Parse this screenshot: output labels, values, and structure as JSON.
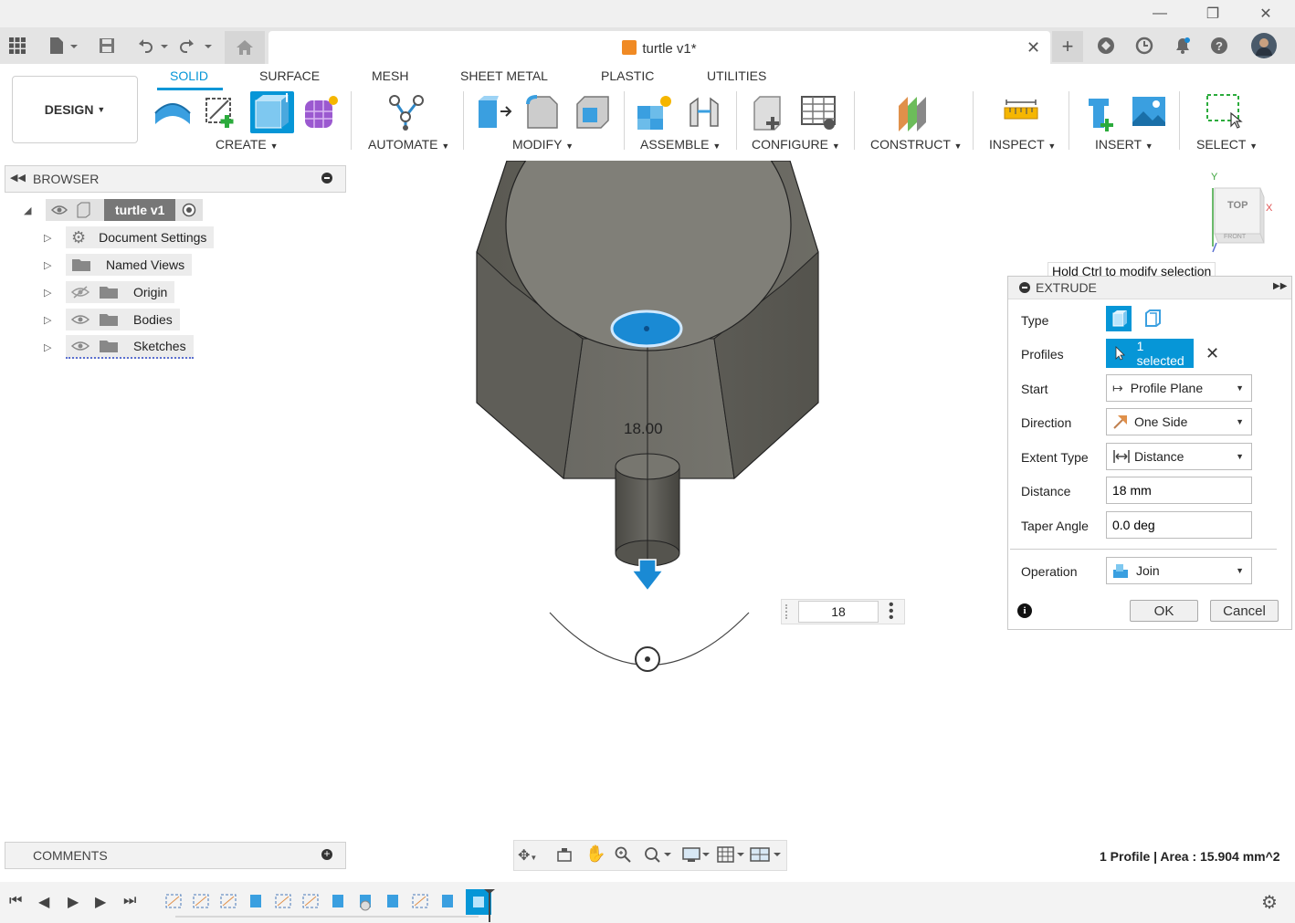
{
  "window": {
    "minimize_icon": "minimize-icon",
    "maximize_icon": "restore-icon",
    "close_icon": "close-icon"
  },
  "document": {
    "title": "turtle v1*"
  },
  "ribbon": {
    "tabs": [
      "SOLID",
      "SURFACE",
      "MESH",
      "SHEET METAL",
      "PLASTIC",
      "UTILITIES"
    ],
    "active_tab": "SOLID",
    "workspace": "DESIGN",
    "groups": [
      "CREATE",
      "AUTOMATE",
      "MODIFY",
      "ASSEMBLE",
      "CONFIGURE",
      "CONSTRUCT",
      "INSPECT",
      "INSERT",
      "SELECT"
    ]
  },
  "browser": {
    "title": "BROWSER",
    "root": "turtle v1",
    "items": [
      "Document Settings",
      "Named Views",
      "Origin",
      "Bodies",
      "Sketches"
    ]
  },
  "comments": {
    "title": "COMMENTS"
  },
  "viewport": {
    "dimension_label": "18.00",
    "dimension_input": "18",
    "viewcube_top": "TOP",
    "viewcube_front": "FRONT",
    "axis_x": "X",
    "axis_y": "Y"
  },
  "tooltip": "Hold Ctrl to modify selection",
  "extrude": {
    "title": "EXTRUDE",
    "type_label": "Type",
    "profiles_label": "Profiles",
    "profiles_value": "1 selected",
    "start_label": "Start",
    "start_value": "Profile Plane",
    "direction_label": "Direction",
    "direction_value": "One Side",
    "extent_label": "Extent Type",
    "extent_value": "Distance",
    "distance_label": "Distance",
    "distance_value": "18 mm",
    "taper_label": "Taper Angle",
    "taper_value": "0.0 deg",
    "operation_label": "Operation",
    "operation_value": "Join",
    "ok": "OK",
    "cancel": "Cancel"
  },
  "status": "1 Profile | Area : 15.904 mm^2",
  "colors": {
    "accent": "#0696d7",
    "selection": "#1a8ad4",
    "body": "#5f5e58"
  }
}
